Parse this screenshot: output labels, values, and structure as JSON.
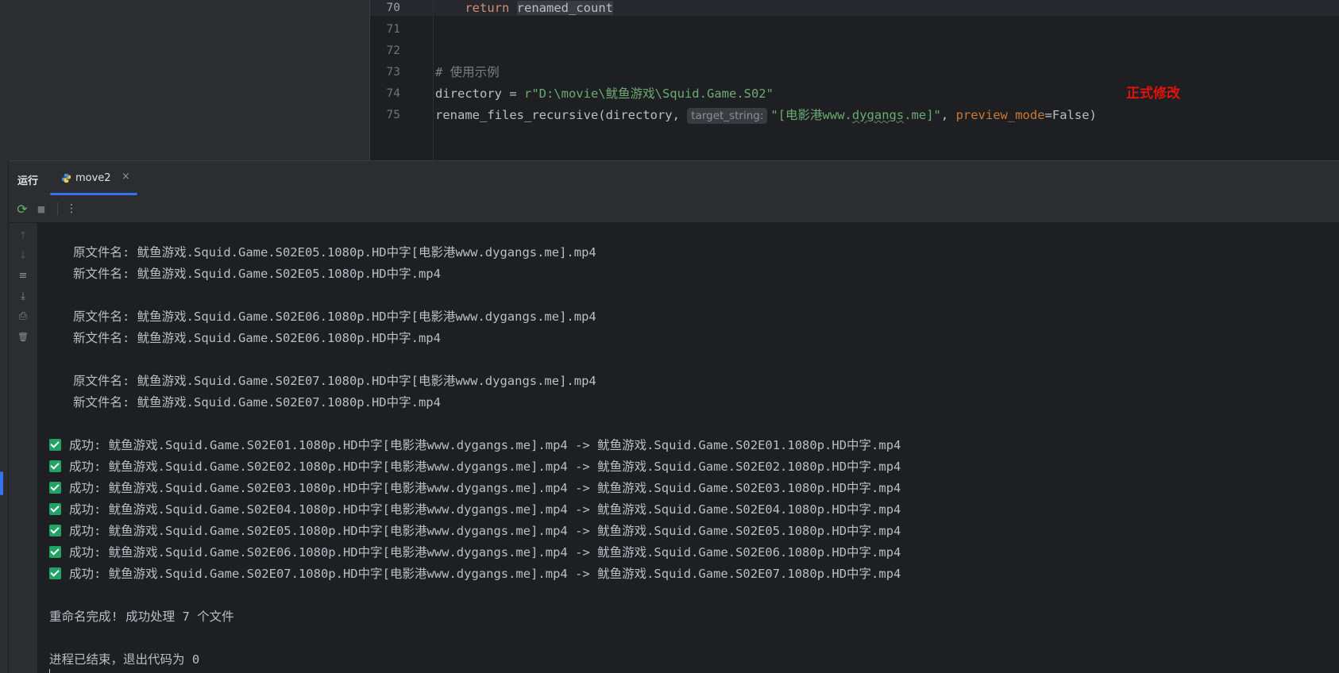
{
  "editor": {
    "lines": [
      {
        "n": "70",
        "parts": [
          {
            "t": "    ",
            "c": ""
          },
          {
            "t": "return",
            "c": "kw"
          },
          {
            "t": " ",
            "c": ""
          },
          {
            "t": "renamed_count",
            "c": "hl"
          }
        ]
      },
      {
        "n": "71",
        "parts": []
      },
      {
        "n": "72",
        "parts": []
      },
      {
        "n": "73",
        "parts": [
          {
            "t": "# 使用示例",
            "c": "cmt"
          }
        ]
      },
      {
        "n": "74",
        "parts": [
          {
            "t": "directory = ",
            "c": ""
          },
          {
            "t": "r\"D:\\movie\\鱿鱼游戏\\Squid.Game.S02\"",
            "c": "str"
          }
        ]
      },
      {
        "n": "75",
        "parts": [
          {
            "t": "rename_files_recursive(directory, ",
            "c": ""
          },
          {
            "t": "target_string:",
            "c": "hint"
          },
          {
            "t": "\"[电影港www.",
            "c": "str"
          },
          {
            "t": "dygangs",
            "c": "str sq"
          },
          {
            "t": ".me]\"",
            "c": "str"
          },
          {
            "t": ", ",
            "c": ""
          },
          {
            "t": "preview_mode",
            "c": "param2"
          },
          {
            "t": "=False)",
            "c": ""
          }
        ]
      }
    ],
    "annotation": "正式修改"
  },
  "run_panel": {
    "title": "运行",
    "tab_label": "move2",
    "close_glyph": "×"
  },
  "toolbar": {
    "rerun_icon": "⟳",
    "stop_icon": "■",
    "more_icon": "⋮"
  },
  "side_icons": [
    "↑",
    "↓",
    "≡",
    "⤓",
    "⎙",
    "🗑"
  ],
  "console": {
    "preview": [
      {
        "orig": "原文件名: 鱿鱼游戏.Squid.Game.S02E05.1080p.HD中字[电影港www.dygangs.me].mp4",
        "new": "新文件名: 鱿鱼游戏.Squid.Game.S02E05.1080p.HD中字.mp4"
      },
      {
        "orig": "原文件名: 鱿鱼游戏.Squid.Game.S02E06.1080p.HD中字[电影港www.dygangs.me].mp4",
        "new": "新文件名: 鱿鱼游戏.Squid.Game.S02E06.1080p.HD中字.mp4"
      },
      {
        "orig": "原文件名: 鱿鱼游戏.Squid.Game.S02E07.1080p.HD中字[电影港www.dygangs.me].mp4",
        "new": "新文件名: 鱿鱼游戏.Squid.Game.S02E07.1080p.HD中字.mp4"
      }
    ],
    "success": [
      "成功: 鱿鱼游戏.Squid.Game.S02E01.1080p.HD中字[电影港www.dygangs.me].mp4 -> 鱿鱼游戏.Squid.Game.S02E01.1080p.HD中字.mp4",
      "成功: 鱿鱼游戏.Squid.Game.S02E02.1080p.HD中字[电影港www.dygangs.me].mp4 -> 鱿鱼游戏.Squid.Game.S02E02.1080p.HD中字.mp4",
      "成功: 鱿鱼游戏.Squid.Game.S02E03.1080p.HD中字[电影港www.dygangs.me].mp4 -> 鱿鱼游戏.Squid.Game.S02E03.1080p.HD中字.mp4",
      "成功: 鱿鱼游戏.Squid.Game.S02E04.1080p.HD中字[电影港www.dygangs.me].mp4 -> 鱿鱼游戏.Squid.Game.S02E04.1080p.HD中字.mp4",
      "成功: 鱿鱼游戏.Squid.Game.S02E05.1080p.HD中字[电影港www.dygangs.me].mp4 -> 鱿鱼游戏.Squid.Game.S02E05.1080p.HD中字.mp4",
      "成功: 鱿鱼游戏.Squid.Game.S02E06.1080p.HD中字[电影港www.dygangs.me].mp4 -> 鱿鱼游戏.Squid.Game.S02E06.1080p.HD中字.mp4",
      "成功: 鱿鱼游戏.Squid.Game.S02E07.1080p.HD中字[电影港www.dygangs.me].mp4 -> 鱿鱼游戏.Squid.Game.S02E07.1080p.HD中字.mp4"
    ],
    "summary": "重命名完成! 成功处理 7 个文件",
    "exit": "进程已结束，退出代码为 0"
  },
  "colors": {
    "accent": "#3574f0",
    "success_check": "#21a366",
    "annotation": "#e3120b",
    "keyword": "#cf8e6d",
    "string": "#6aab73"
  }
}
